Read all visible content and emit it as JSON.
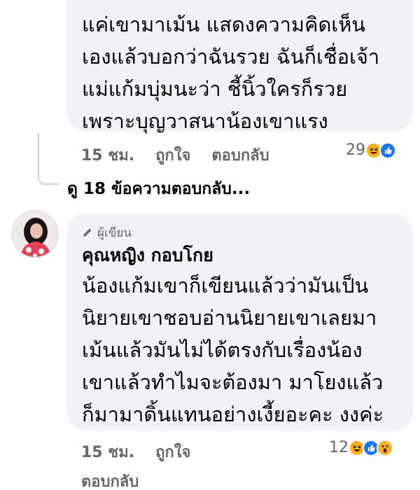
{
  "comment1": {
    "lines": [
      "แค่เขามาเม้น แสดงความคิดเห็น",
      "เองแล้วบอกว่าฉันรวย ฉันก็เชื่อเจ้า",
      "แม่แก้มบุ่มนะว่า ชี้นิ้วใครก็รวย",
      "เพราะบุญวาสนาน้องเขาแรง"
    ],
    "time": "15 ชม.",
    "like": "ถูกใจ",
    "reply": "ตอบกลับ",
    "reaction_count": "29",
    "reactions": [
      "haha-icon",
      "like-icon"
    ]
  },
  "view_replies": "ดู 18 ข้อความตอบกลับ...",
  "comment2": {
    "badge": "ผู้เขียน",
    "author": "คุณหญิง กอบโกย",
    "lines": [
      "น้องแก้มเขาก็เขียนแล้วว่ามันเป็น",
      "นิยายเขาชอบอ่านนิยายเขาเลยมา",
      "เม้นแล้วมันไม่ได้ตรงกับเรื่องน้อง",
      "เขาแล้วทำไมจะต้องมา มาโยงแล้ว",
      "ก็มามาดิ้นแทนอย่างเงี้ยอะคะ งงค่ะ"
    ],
    "time": "15 ชม.",
    "like": "ถูกใจ",
    "reply": "ตอบกลับ",
    "reaction_count": "12",
    "reactions": [
      "haha-icon",
      "like-icon",
      "wow-icon"
    ]
  },
  "colors": {
    "bubble": "#f0f2f5",
    "meta": "#65676b",
    "like_blue": "#1877f2",
    "haha_yellow": "#f7b125"
  }
}
